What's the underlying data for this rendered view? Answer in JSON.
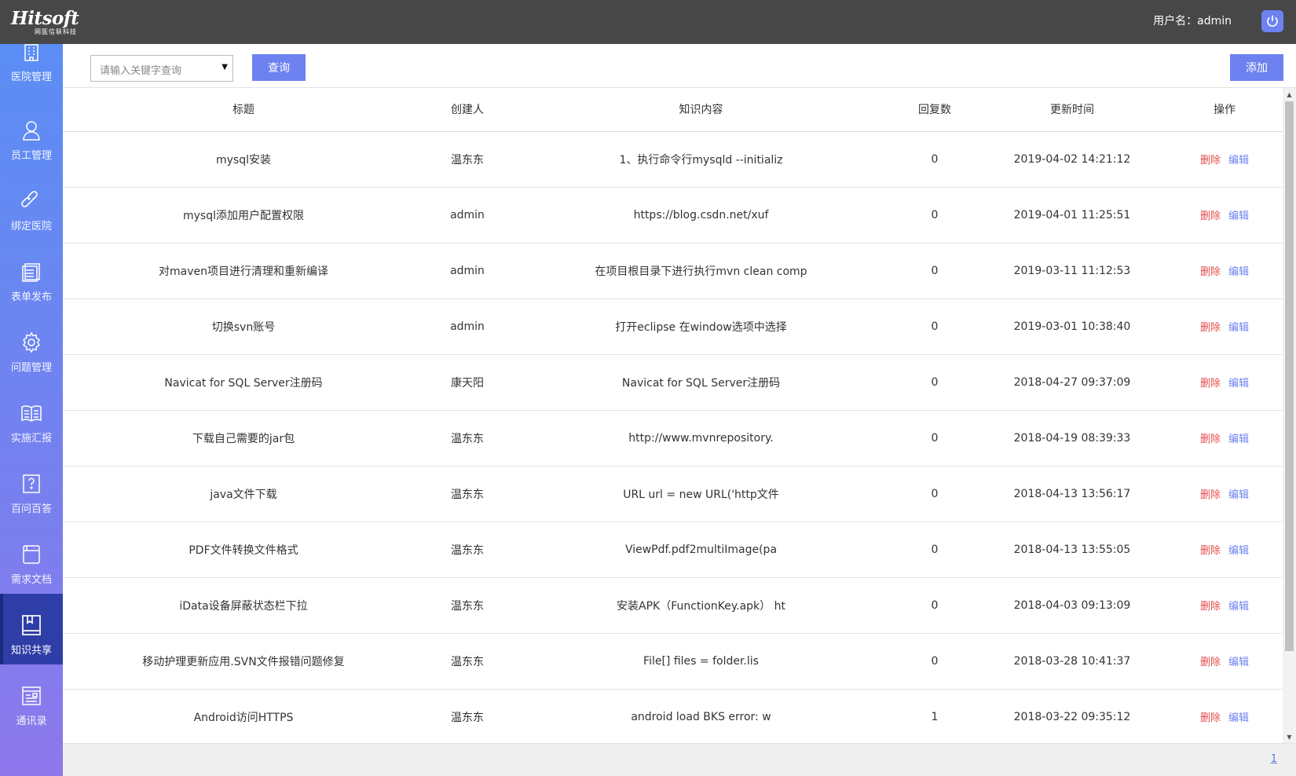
{
  "header": {
    "logo_text": "Hitsoft",
    "logo_subtext": "网医信联科技",
    "user_label": "用户名：admin"
  },
  "sidebar": {
    "items": [
      {
        "label": "医院管理",
        "icon": "hospital-icon"
      },
      {
        "label": "员工管理",
        "icon": "user-icon"
      },
      {
        "label": "绑定医院",
        "icon": "link-icon"
      },
      {
        "label": "表单发布",
        "icon": "form-icon"
      },
      {
        "label": "问题管理",
        "icon": "gear-icon"
      },
      {
        "label": "实施汇报",
        "icon": "book-icon"
      },
      {
        "label": "百问百答",
        "icon": "question-icon"
      },
      {
        "label": "需求文档",
        "icon": "document-icon"
      },
      {
        "label": "知识共享",
        "icon": "knowledge-book-icon",
        "active": true
      },
      {
        "label": "通讯录",
        "icon": "contacts-icon"
      }
    ]
  },
  "toolbar": {
    "search_placeholder": "请输入关键字查询",
    "search_button": "查询",
    "add_button": "添加"
  },
  "table": {
    "columns": [
      "标题",
      "创建人",
      "知识内容",
      "回复数",
      "更新时间",
      "操作"
    ],
    "delete_label": "删除",
    "edit_label": "编辑",
    "rows": [
      {
        "title": "mysql安装",
        "creator": "温东东",
        "content": "1、执行命令行mysqld --initializ",
        "replies": "0",
        "updated": "2019-04-02 14:21:12"
      },
      {
        "title": "mysql添加用户配置权限",
        "creator": "admin",
        "content": "https://blog.csdn.net/xuf",
        "replies": "0",
        "updated": "2019-04-01 11:25:51"
      },
      {
        "title": "对maven项目进行清理和重新编译",
        "creator": "admin",
        "content": "在项目根目录下进行执行mvn clean comp",
        "replies": "0",
        "updated": "2019-03-11 11:12:53"
      },
      {
        "title": "切换svn账号",
        "creator": "admin",
        "content": "打开eclipse 在window选项中选择",
        "replies": "0",
        "updated": "2019-03-01 10:38:40"
      },
      {
        "title": "Navicat for SQL Server注册码",
        "creator": "康天阳",
        "content": "Navicat for SQL Server注册码",
        "replies": "0",
        "updated": "2018-04-27 09:37:09"
      },
      {
        "title": "下载自己需要的jar包",
        "creator": "温东东",
        "content": "http://www.mvnrepository.",
        "replies": "0",
        "updated": "2018-04-19 08:39:33"
      },
      {
        "title": "java文件下载",
        "creator": "温东东",
        "content": "URL url = new URL('http文件",
        "replies": "0",
        "updated": "2018-04-13 13:56:17"
      },
      {
        "title": "PDF文件转换文件格式",
        "creator": "温东东",
        "content": "ViewPdf.pdf2multiImage(pa",
        "replies": "0",
        "updated": "2018-04-13 13:55:05"
      },
      {
        "title": "iData设备屏蔽状态栏下拉",
        "creator": "温东东",
        "content": "安装APK（FunctionKey.apk） ht",
        "replies": "0",
        "updated": "2018-04-03 09:13:09"
      },
      {
        "title": "移动护理更新应用.SVN文件报错问题修复",
        "creator": "温东东",
        "content": "File[] files = folder.lis",
        "replies": "0",
        "updated": "2018-03-28 10:41:37"
      },
      {
        "title": "Android访问HTTPS",
        "creator": "温东东",
        "content": "android load BKS error: w",
        "replies": "1",
        "updated": "2018-03-22 09:35:12"
      }
    ]
  },
  "pagination": {
    "current_page": "1"
  }
}
